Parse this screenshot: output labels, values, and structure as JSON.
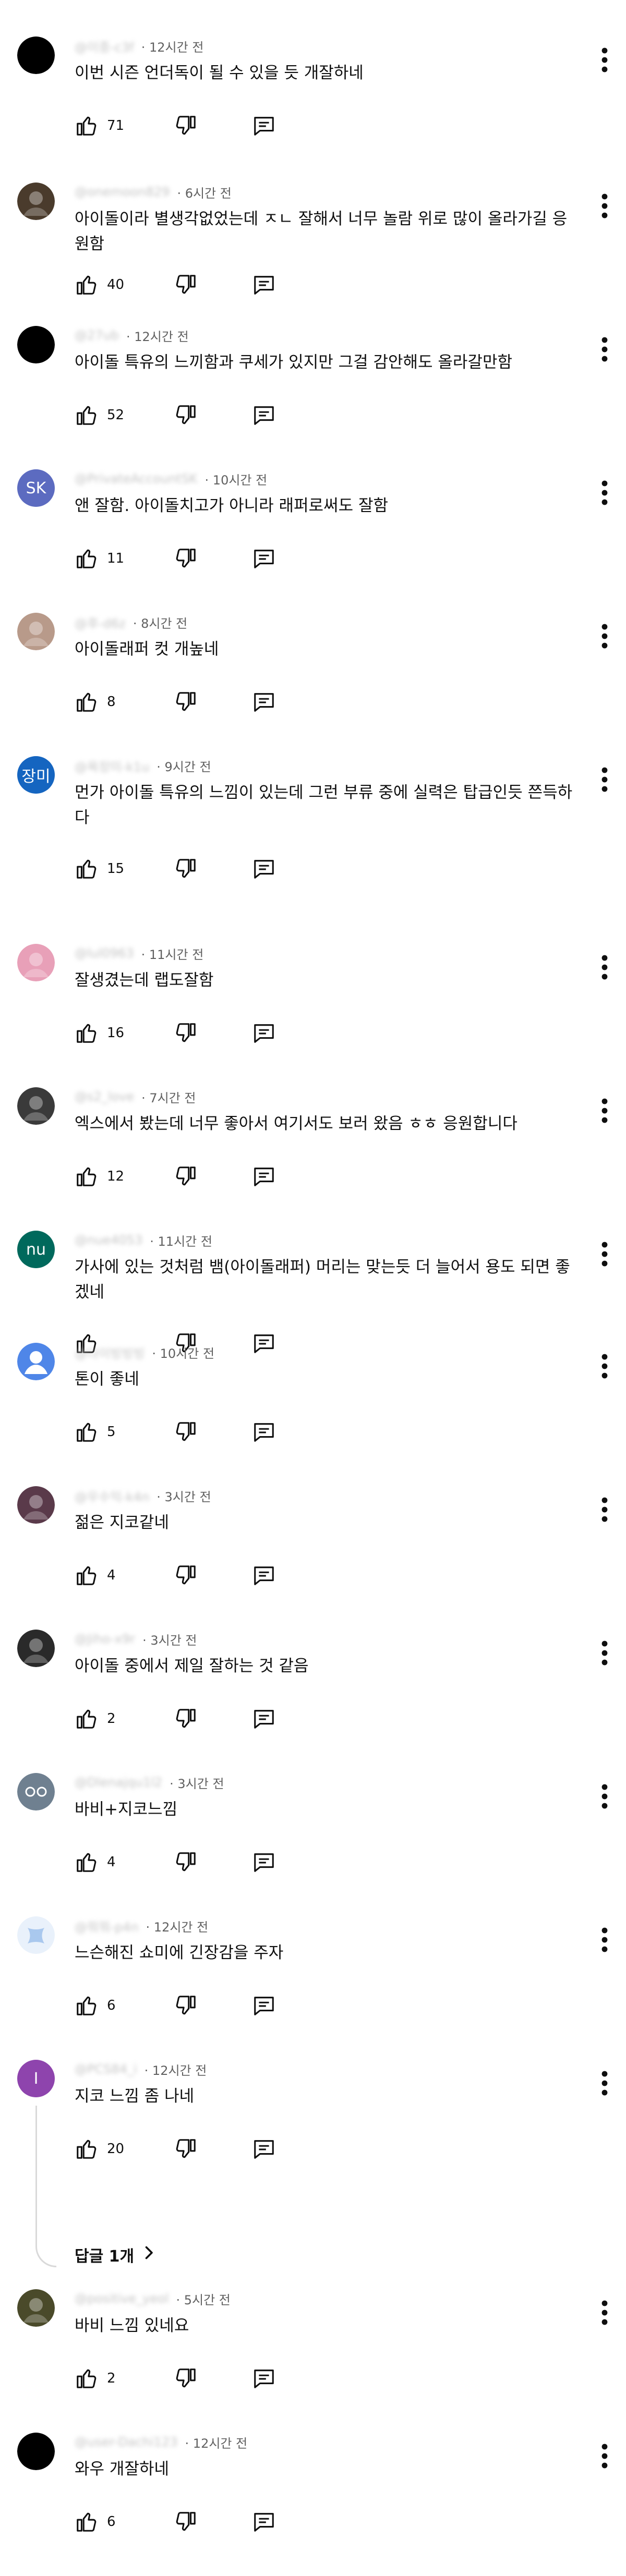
{
  "comments": [
    {
      "handle": "@이중-c3f",
      "time": "12시간 전",
      "text": "이번 시즌 언더독이 될 수 있을 듯 개잘하네",
      "likes": "71",
      "avatar": {
        "kind": "black"
      }
    },
    {
      "handle": "@onemoon829",
      "time": "6시간 전",
      "text": "아이돌이라 별생각없었는데 ㅈㄴ 잘해서 너무 놀람 위로 많이 올라가길 응원함",
      "likes": "40",
      "avatar": {
        "kind": "photo",
        "color": "#4a3b2c"
      }
    },
    {
      "handle": "@27ub",
      "time": "12시간 전",
      "text": "아이돌 특유의 느끼함과 쿠세가 있지만 그걸 감안해도 올라갈만함",
      "likes": "52",
      "avatar": {
        "kind": "black"
      }
    },
    {
      "handle": "@PrivateAccountSK",
      "time": "10시간 전",
      "text": "앤 잘함. 아이돌치고가 아니라 래퍼로써도 잘함",
      "likes": "11",
      "avatar": {
        "kind": "initial",
        "initial": "SK",
        "color": "#5c6bc0"
      }
    },
    {
      "handle": "@후-d6z",
      "time": "8시간 전",
      "text": "아이돌래퍼 컷 개높네",
      "likes": "8",
      "avatar": {
        "kind": "photo",
        "color": "#b89a8a"
      }
    },
    {
      "handle": "@욕장미-k1u",
      "time": "9시간 전",
      "text": "먼가 아이돌 특유의 느낌이 있는데 그런 부류 중에 실력은 탑급인듯 쯘득하다",
      "likes": "15",
      "avatar": {
        "kind": "initial",
        "initial": "장미",
        "color": "#1565c0"
      }
    },
    {
      "handle": "@lul0963",
      "time": "11시간 전",
      "text": "잘생겼는데 랩도잘함",
      "likes": "16",
      "avatar": {
        "kind": "photo",
        "color": "#e8a0b8"
      }
    },
    {
      "handle": "@s2_love",
      "time": "7시간 전",
      "text": "엑스에서 봤는데 너무 좋아서 여기서도 보러 왔음 ㅎㅎ 응원합니다",
      "likes": "12",
      "avatar": {
        "kind": "photo",
        "color": "#3a3a3a"
      }
    },
    {
      "handle": "@nue4053",
      "time": "11시간 전",
      "text": "가사에 있는 것처럼 뱀(아이돌래퍼) 머리는 맞는듯 더 늘어서 용도 되면 좋겠네",
      "likes": "",
      "avatar": {
        "kind": "initial",
        "initial": "nu",
        "color": "#00695c"
      }
    },
    {
      "handle": "@다이빙빙빙",
      "time": "10시간 전",
      "text": "톤이 좋네",
      "likes": "5",
      "avatar": {
        "kind": "default",
        "color": "#4f86e8"
      }
    },
    {
      "handle": "@우수익-k4n",
      "time": "3시간 전",
      "text": "젊은 지코같네",
      "likes": "4",
      "avatar": {
        "kind": "photo",
        "color": "#5a3a4a"
      }
    },
    {
      "handle": "@Jiho-x9r",
      "time": "3시간 전",
      "text": "아이돌 중에서 제일 잘하는 것 같음",
      "likes": "2",
      "avatar": {
        "kind": "photo",
        "color": "#2a2a2a"
      }
    },
    {
      "handle": "@Dlenajqu1l2",
      "time": "3시간 전",
      "text": "바비+지코느낌",
      "likes": "4",
      "avatar": {
        "kind": "face",
        "color": "#6f8090"
      }
    },
    {
      "handle": "@뭐뭐-p4n",
      "time": "12시간 전",
      "text": "느슨해진 쇼미에 긴장감을 주자",
      "likes": "6",
      "avatar": {
        "kind": "ribbon",
        "color": "#a9c8ee"
      }
    },
    {
      "handle": "@PCS84_i",
      "time": "12시간 전",
      "text": "지코 느낌 좀 나네",
      "likes": "20",
      "avatar": {
        "kind": "initial",
        "initial": "I",
        "color": "#8e44ad"
      },
      "replies_label": "답글 1개"
    },
    {
      "handle": "@positive_yeol",
      "time": "5시간 전",
      "text": "바비 느낌 있네요",
      "likes": "2",
      "avatar": {
        "kind": "photo",
        "color": "#4a4a2a"
      }
    },
    {
      "handle": "@user-Dachi123",
      "time": "12시간 전",
      "text": "와우 개잘하네",
      "likes": "6",
      "avatar": {
        "kind": "black"
      }
    }
  ],
  "icons": {
    "like": "thumbs-up-icon",
    "dislike": "thumbs-down-icon",
    "reply": "reply-comment-icon",
    "more": "more-vertical-icon",
    "chevron": "chevron-right-icon"
  }
}
